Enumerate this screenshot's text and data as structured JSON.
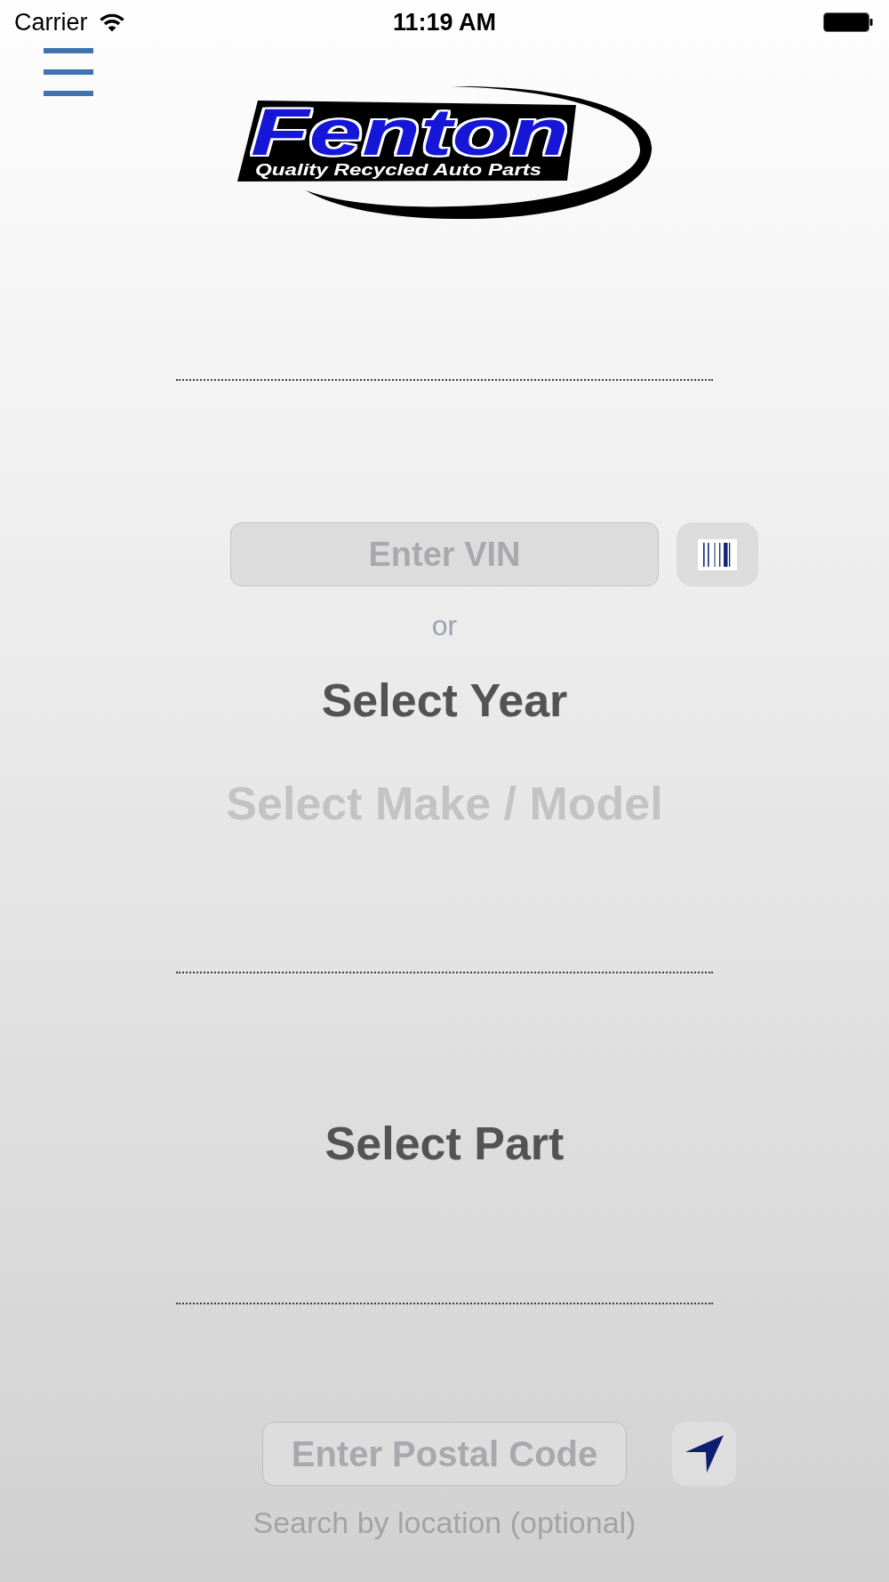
{
  "status_bar": {
    "carrier": "Carrier",
    "time": "11:19 AM"
  },
  "logo": {
    "wordmark": "Fenton",
    "tagline": "Quality Recycled Auto Parts"
  },
  "vehicle": {
    "vin_field": {
      "placeholder": "Enter VIN"
    },
    "separator": "or",
    "year_selector": {
      "label": "Select Year",
      "disabled": false
    },
    "make_model_selector": {
      "label": "Select Make / Model",
      "disabled": true
    }
  },
  "part_selector": {
    "label": "Select Part",
    "disabled": false
  },
  "location": {
    "postal_code_field": {
      "placeholder": "Enter Postal Code"
    },
    "hint": "Search by location (optional)"
  }
}
